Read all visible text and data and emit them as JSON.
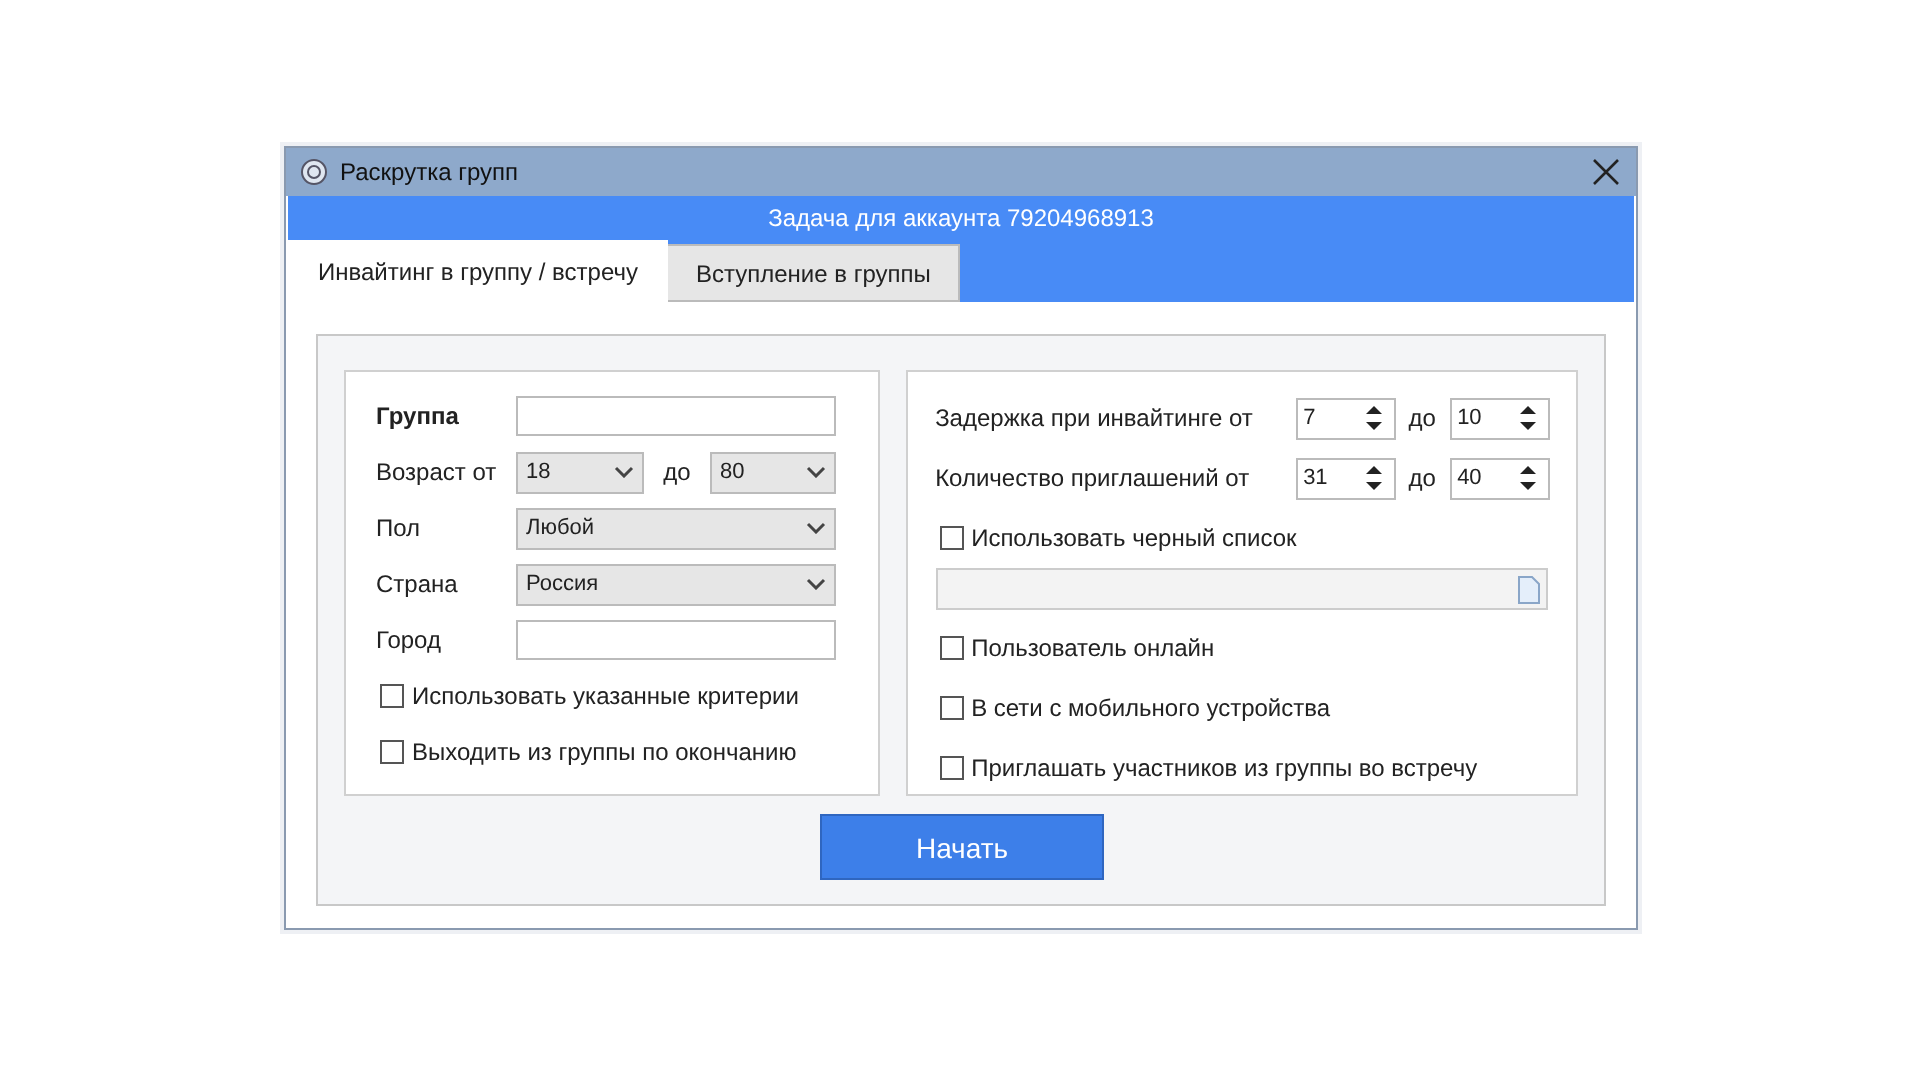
{
  "window": {
    "title": "Раскрутка групп"
  },
  "header": "Задача для аккаунта 79204968913",
  "tabs": [
    {
      "label": "Инвайтинг в группу / встречу",
      "selected": true
    },
    {
      "label": "Вступление в группы",
      "selected": false
    }
  ],
  "left": {
    "rows": [
      {
        "kind": "text",
        "label": "Группа",
        "bold": true
      },
      {
        "kind": "range",
        "label": "Возраст от",
        "from": "18",
        "sep": "до",
        "to": "80"
      },
      {
        "kind": "select",
        "label": "Пол",
        "value": "Любой"
      },
      {
        "kind": "select",
        "label": "Страна",
        "value": "Россия"
      },
      {
        "kind": "text",
        "label": "Город",
        "bold": false
      }
    ],
    "checks": [
      {
        "label": "Использовать указанные критерии",
        "checked": false
      },
      {
        "label": "Выходить из группы по окончанию",
        "checked": false
      }
    ]
  },
  "right": {
    "spins": [
      {
        "label": "Задержка при инвайтинге от",
        "from": "7",
        "sep": "до",
        "to": "10"
      },
      {
        "label": "Количество приглашений от",
        "from": "31",
        "sep": "до",
        "to": "40"
      }
    ],
    "items": [
      {
        "kind": "check",
        "label": "Использовать черный список",
        "checked": false
      },
      {
        "kind": "file"
      },
      {
        "kind": "check",
        "label": "Пользователь онлайн",
        "checked": false
      },
      {
        "kind": "check",
        "label": "В сети с мобильного устройства",
        "checked": false
      },
      {
        "kind": "check",
        "label": "Приглашать участников из группы во встречу",
        "checked": false
      }
    ]
  },
  "button": "Начать"
}
